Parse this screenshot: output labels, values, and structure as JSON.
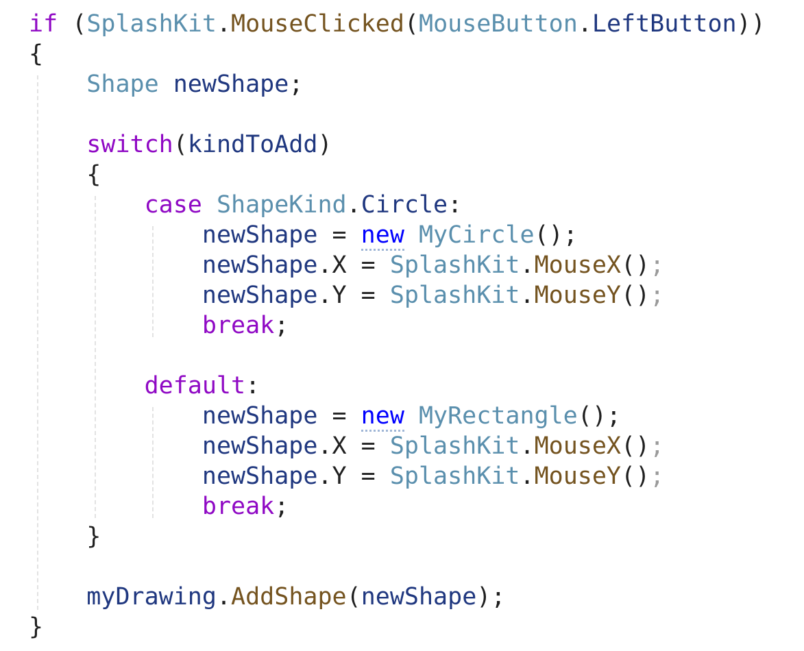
{
  "code": {
    "lines": [
      [
        {
          "t": "if",
          "c": "kw-ctrl"
        },
        {
          "t": " (",
          "c": "punct"
        },
        {
          "t": "SplashKit",
          "c": "type"
        },
        {
          "t": ".",
          "c": "punct"
        },
        {
          "t": "MouseClicked",
          "c": "method"
        },
        {
          "t": "(",
          "c": "punct"
        },
        {
          "t": "MouseButton",
          "c": "type"
        },
        {
          "t": ".",
          "c": "punct"
        },
        {
          "t": "LeftButton",
          "c": "prop"
        },
        {
          "t": "))",
          "c": "punct"
        }
      ],
      [
        {
          "t": "{",
          "c": "punct"
        }
      ],
      [
        {
          "t": "    ",
          "c": "punct"
        },
        {
          "t": "Shape",
          "c": "type"
        },
        {
          "t": " ",
          "c": "punct"
        },
        {
          "t": "newShape",
          "c": "ident"
        },
        {
          "t": ";",
          "c": "punct"
        }
      ],
      [],
      [
        {
          "t": "    ",
          "c": "punct"
        },
        {
          "t": "switch",
          "c": "kw-ctrl"
        },
        {
          "t": "(",
          "c": "punct"
        },
        {
          "t": "kindToAdd",
          "c": "ident"
        },
        {
          "t": ")",
          "c": "punct"
        }
      ],
      [
        {
          "t": "    {",
          "c": "punct"
        }
      ],
      [
        {
          "t": "        ",
          "c": "punct"
        },
        {
          "t": "case",
          "c": "kw-ctrl"
        },
        {
          "t": " ",
          "c": "punct"
        },
        {
          "t": "ShapeKind",
          "c": "type"
        },
        {
          "t": ".",
          "c": "punct"
        },
        {
          "t": "Circle",
          "c": "prop"
        },
        {
          "t": ":",
          "c": "punct"
        }
      ],
      [
        {
          "t": "            ",
          "c": "punct"
        },
        {
          "t": "newShape",
          "c": "ident"
        },
        {
          "t": " = ",
          "c": "punct"
        },
        {
          "t": "new",
          "c": "kw-new"
        },
        {
          "t": " ",
          "c": "punct"
        },
        {
          "t": "MyCircle",
          "c": "type"
        },
        {
          "t": "();",
          "c": "punct"
        }
      ],
      [
        {
          "t": "            ",
          "c": "punct"
        },
        {
          "t": "newShape",
          "c": "ident"
        },
        {
          "t": ".",
          "c": "punct"
        },
        {
          "t": "X",
          "c": "punct"
        },
        {
          "t": " = ",
          "c": "punct"
        },
        {
          "t": "SplashKit",
          "c": "type"
        },
        {
          "t": ".",
          "c": "punct"
        },
        {
          "t": "MouseX",
          "c": "method"
        },
        {
          "t": "()",
          "c": "punct"
        },
        {
          "t": ";",
          "c": "faint"
        }
      ],
      [
        {
          "t": "            ",
          "c": "punct"
        },
        {
          "t": "newShape",
          "c": "ident"
        },
        {
          "t": ".",
          "c": "punct"
        },
        {
          "t": "Y",
          "c": "punct"
        },
        {
          "t": " = ",
          "c": "punct"
        },
        {
          "t": "SplashKit",
          "c": "type"
        },
        {
          "t": ".",
          "c": "punct"
        },
        {
          "t": "MouseY",
          "c": "method"
        },
        {
          "t": "()",
          "c": "punct"
        },
        {
          "t": ";",
          "c": "faint"
        }
      ],
      [
        {
          "t": "            ",
          "c": "punct"
        },
        {
          "t": "break",
          "c": "kw-ctrl"
        },
        {
          "t": ";",
          "c": "punct"
        }
      ],
      [],
      [
        {
          "t": "        ",
          "c": "punct"
        },
        {
          "t": "default",
          "c": "kw-ctrl"
        },
        {
          "t": ":",
          "c": "punct"
        }
      ],
      [
        {
          "t": "            ",
          "c": "punct"
        },
        {
          "t": "newShape",
          "c": "ident"
        },
        {
          "t": " = ",
          "c": "punct"
        },
        {
          "t": "new",
          "c": "kw-new"
        },
        {
          "t": " ",
          "c": "punct"
        },
        {
          "t": "MyRectangle",
          "c": "type"
        },
        {
          "t": "();",
          "c": "punct"
        }
      ],
      [
        {
          "t": "            ",
          "c": "punct"
        },
        {
          "t": "newShape",
          "c": "ident"
        },
        {
          "t": ".",
          "c": "punct"
        },
        {
          "t": "X",
          "c": "punct"
        },
        {
          "t": " = ",
          "c": "punct"
        },
        {
          "t": "SplashKit",
          "c": "type"
        },
        {
          "t": ".",
          "c": "punct"
        },
        {
          "t": "MouseX",
          "c": "method"
        },
        {
          "t": "()",
          "c": "punct"
        },
        {
          "t": ";",
          "c": "faint"
        }
      ],
      [
        {
          "t": "            ",
          "c": "punct"
        },
        {
          "t": "newShape",
          "c": "ident"
        },
        {
          "t": ".",
          "c": "punct"
        },
        {
          "t": "Y",
          "c": "punct"
        },
        {
          "t": " = ",
          "c": "punct"
        },
        {
          "t": "SplashKit",
          "c": "type"
        },
        {
          "t": ".",
          "c": "punct"
        },
        {
          "t": "MouseY",
          "c": "method"
        },
        {
          "t": "()",
          "c": "punct"
        },
        {
          "t": ";",
          "c": "faint"
        }
      ],
      [
        {
          "t": "            ",
          "c": "punct"
        },
        {
          "t": "break",
          "c": "kw-ctrl"
        },
        {
          "t": ";",
          "c": "punct"
        }
      ],
      [
        {
          "t": "    }",
          "c": "punct"
        }
      ],
      [],
      [
        {
          "t": "    ",
          "c": "punct"
        },
        {
          "t": "myDrawing",
          "c": "ident"
        },
        {
          "t": ".",
          "c": "punct"
        },
        {
          "t": "AddShape",
          "c": "method"
        },
        {
          "t": "(",
          "c": "punct"
        },
        {
          "t": "newShape",
          "c": "ident"
        },
        {
          "t": ");",
          "c": "punct"
        }
      ],
      [
        {
          "t": "}",
          "c": "punct"
        }
      ]
    ]
  },
  "colors": {
    "background": "#ffffff",
    "control_keyword": "#8f08c4",
    "new_keyword": "#0000ff",
    "type_name": "#5a8fad",
    "method_name": "#74531f",
    "identifier": "#1f377f",
    "punctuation": "#1f1f1f",
    "indent_guide": "#e2e2e2"
  }
}
